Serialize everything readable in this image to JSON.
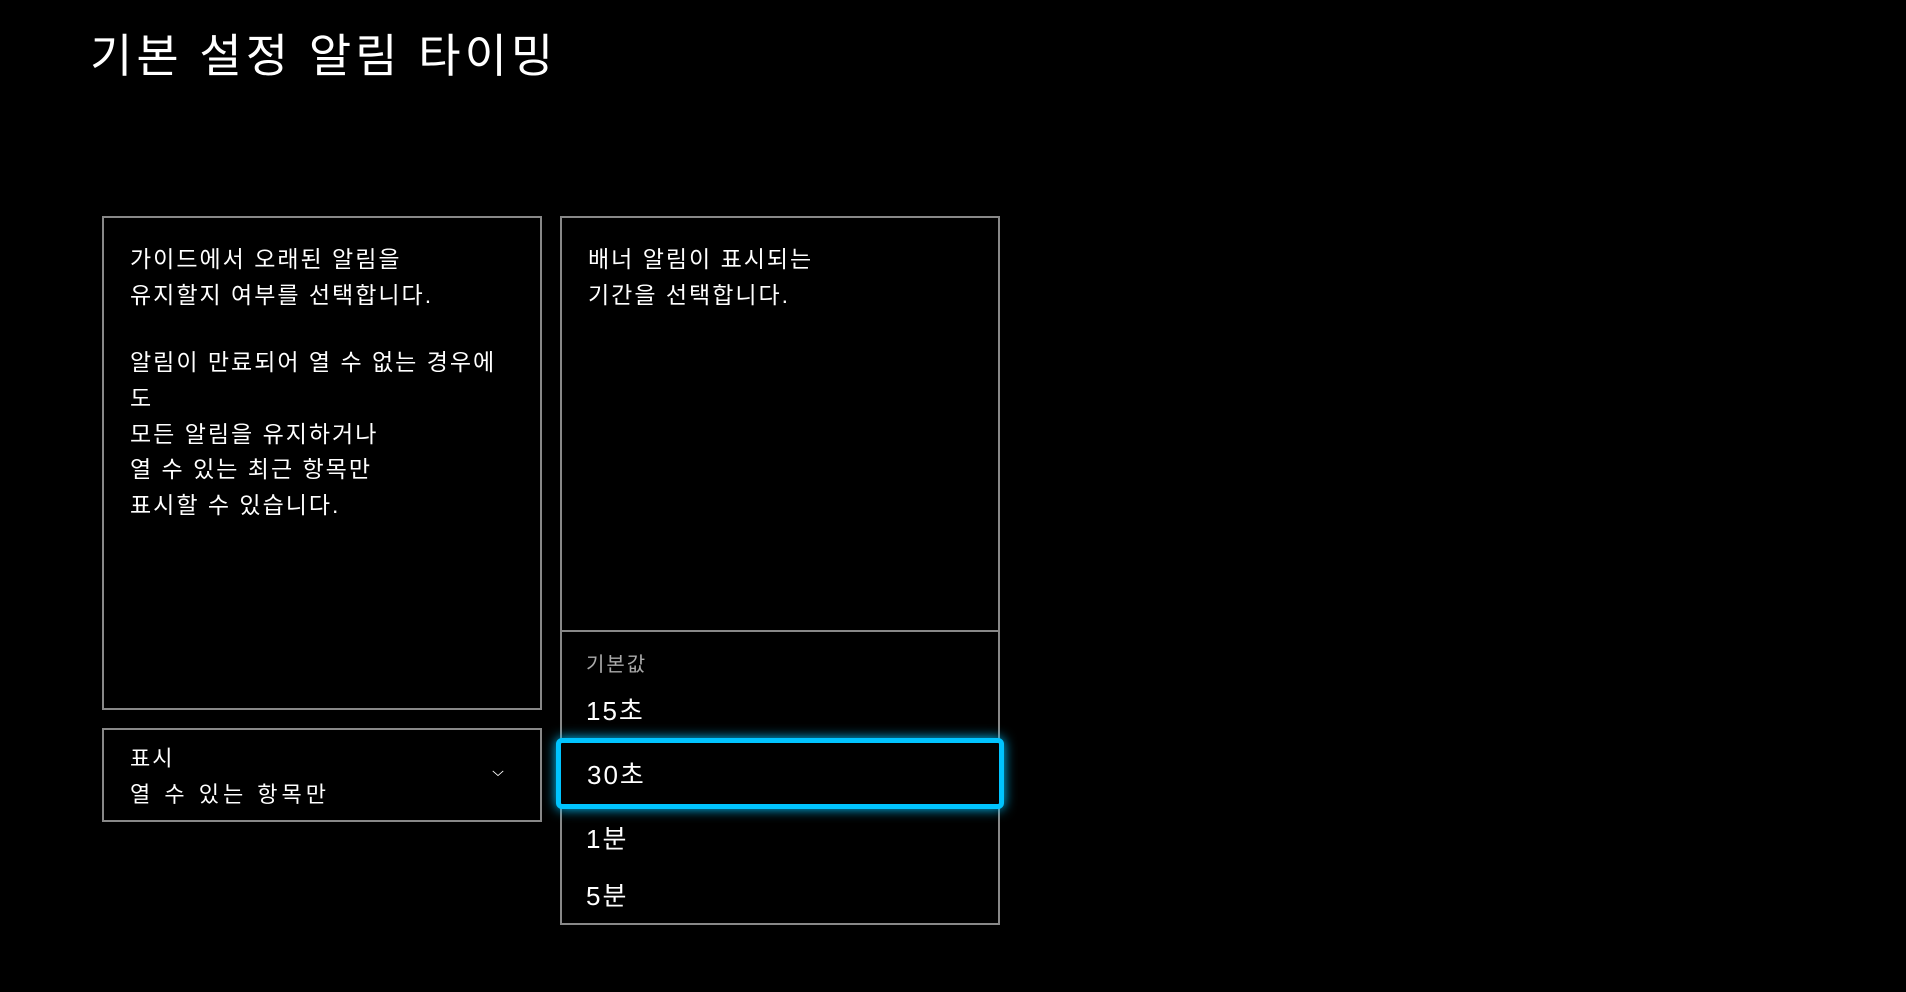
{
  "page": {
    "title": "기본 설정 알림 타이밍"
  },
  "leftColumn": {
    "descLine1": "가이드에서 오래된 알림을",
    "descLine2": "유지할지 여부를 선택합니다.",
    "descLine3": "알림이 만료되어 열 수 없는 경우에도",
    "descLine4": "모든 알림을 유지하거나",
    "descLine5": "열 수 있는 최근 항목만",
    "descLine6": "표시할 수 있습니다.",
    "dropdown": {
      "label": "표시",
      "value": "열 수 있는  항목만"
    }
  },
  "rightColumn": {
    "descLine1": "배너 알림이 표시되는",
    "descLine2": "기간을 선택합니다.",
    "dropdown": {
      "header": "기본값",
      "options": [
        "15초",
        "30초",
        "1분",
        "5분"
      ],
      "selectedIndex": 1
    }
  }
}
